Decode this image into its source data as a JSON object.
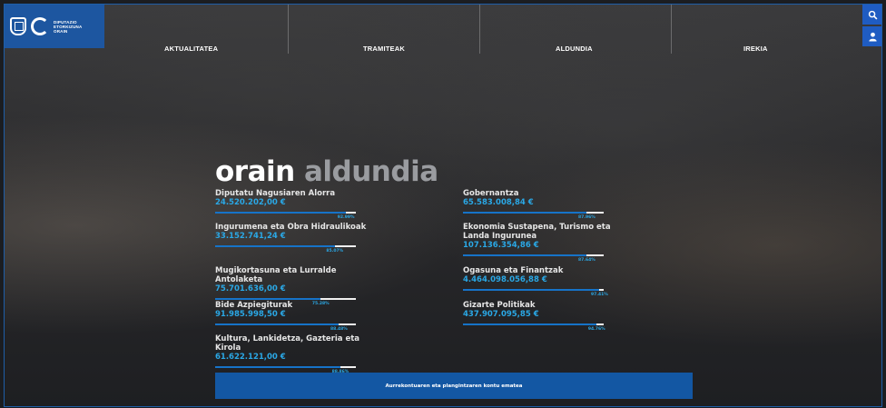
{
  "logo": {
    "lines": [
      "DIPUTAZIO",
      "ETORKIZUNA",
      "ORAIN"
    ]
  },
  "nav": [
    "AKTUALITATEA",
    "TRAMITEAK",
    "ALDUNDIA",
    "IREKIA"
  ],
  "hero": {
    "word1": "orain",
    "word2": "aldundia"
  },
  "departments": [
    {
      "name": "Diputatu Nagusiaren Alorra",
      "amount": "24.520.202,00 €",
      "percent": "92.99%",
      "fraction": 0.93
    },
    {
      "name": "Ingurumena eta Obra Hidraulikoak",
      "amount": "33.152.741,24 €",
      "percent": "85.07%",
      "fraction": 0.85
    },
    {
      "name": "Mugikortasuna eta Lurralde Antolaketa",
      "amount": "75.701.636,00 €",
      "percent": "75.28%",
      "fraction": 0.75
    },
    {
      "name": "Bide Azpiegiturak",
      "amount": "91.985.998,50 €",
      "percent": "88.48%",
      "fraction": 0.88
    },
    {
      "name": "Kultura, Lankidetza, Gazteria eta Kirola",
      "amount": "61.622.121,00 €",
      "percent": "88.86%",
      "fraction": 0.89
    },
    {
      "name": "Gobernantza",
      "amount": "65.583.008,84 €",
      "percent": "87.96%",
      "fraction": 0.88
    },
    {
      "name": "Ekonomia Sustapena, Turismo eta Landa Ingurunea",
      "amount": "107.136.354,86 €",
      "percent": "87.64%",
      "fraction": 0.88
    },
    {
      "name": "Ogasuna eta Finantzak",
      "amount": "4.464.098.056,88 €",
      "percent": "97.41%",
      "fraction": 0.97
    },
    {
      "name": "Gizarte Politikak",
      "amount": "437.907.095,85 €",
      "percent": "94.76%",
      "fraction": 0.95
    }
  ],
  "cta": {
    "label": "Aurrekontuaren eta plangintzaren kontu ematea"
  },
  "icons": {
    "search": "search-icon",
    "user": "user-icon"
  },
  "colors": {
    "brand": "#1d56a0",
    "accent": "#2aa8e6",
    "bar_fill": "#1673c8",
    "cta": "#1357a3"
  }
}
